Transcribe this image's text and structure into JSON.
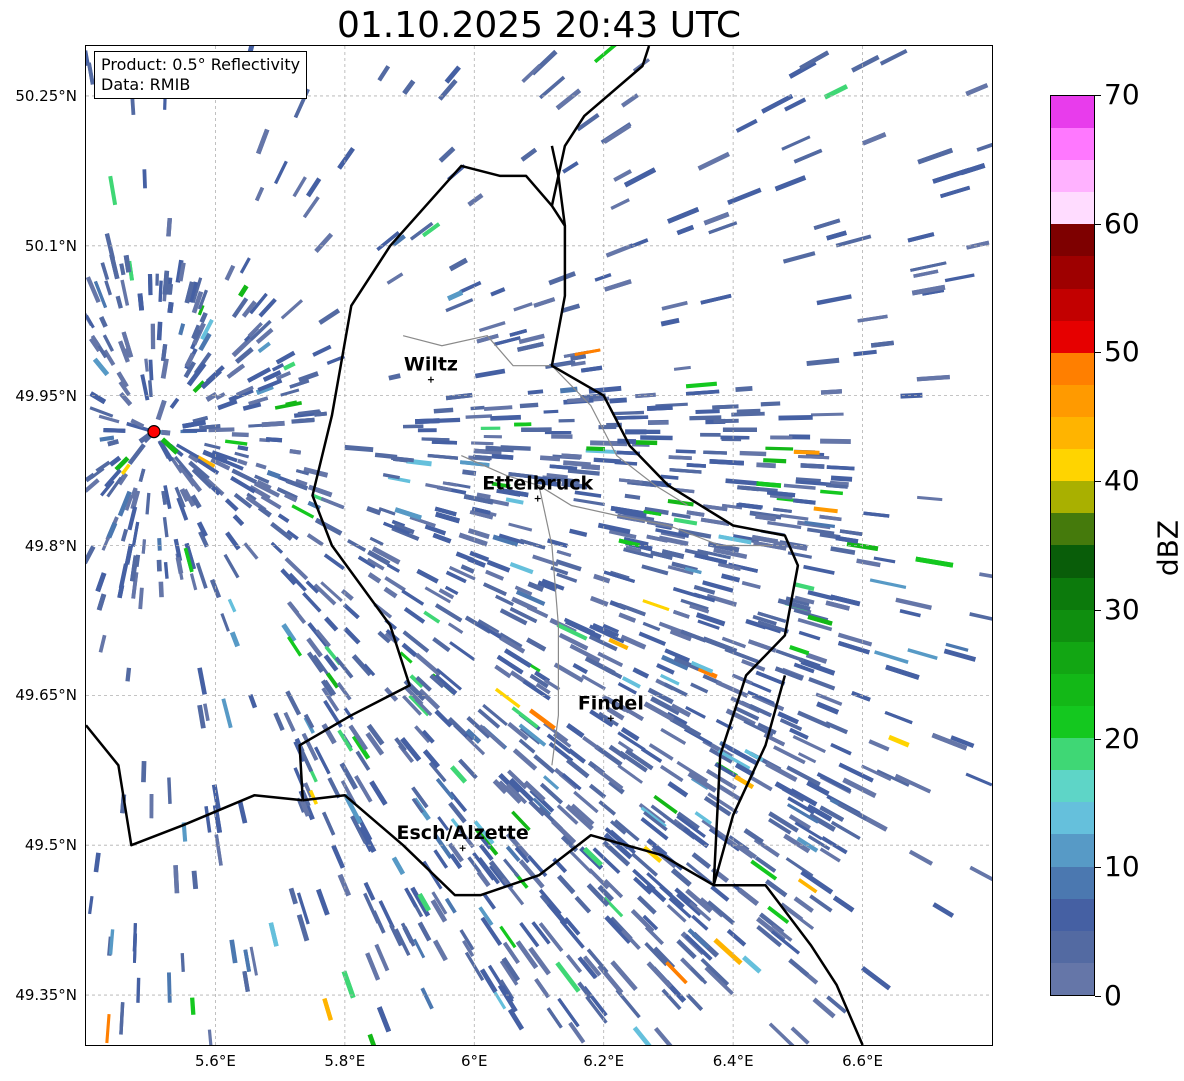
{
  "title": "01.10.2025 20:43 UTC",
  "info": {
    "product": "Product: 0.5° Reflectivity",
    "source": "Data: RMIB"
  },
  "axes": {
    "lon_range": [
      5.4,
      6.8
    ],
    "lat_range": [
      49.3,
      50.3
    ],
    "lat_ticks": [
      {
        "value": 50.25,
        "label": "50.25°N"
      },
      {
        "value": 50.1,
        "label": "50.1°N"
      },
      {
        "value": 49.95,
        "label": "49.95°N"
      },
      {
        "value": 49.8,
        "label": "49.8°N"
      },
      {
        "value": 49.65,
        "label": "49.65°N"
      },
      {
        "value": 49.5,
        "label": "49.5°N"
      },
      {
        "value": 49.35,
        "label": "49.35°N"
      }
    ],
    "lon_ticks": [
      {
        "value": 5.6,
        "label": "5.6°E"
      },
      {
        "value": 5.8,
        "label": "5.8°E"
      },
      {
        "value": 6.0,
        "label": "6°E"
      },
      {
        "value": 6.2,
        "label": "6.2°E"
      },
      {
        "value": 6.4,
        "label": "6.4°E"
      },
      {
        "value": 6.6,
        "label": "6.6°E"
      }
    ],
    "gridlines": true
  },
  "radar_site": {
    "lon": 5.505,
    "lat": 49.914,
    "color": "#ff0000"
  },
  "cities": [
    {
      "name": "Wiltz",
      "lon": 5.933,
      "lat": 49.966
    },
    {
      "name": "Ettelbruck",
      "lon": 6.098,
      "lat": 49.847
    },
    {
      "name": "Findel",
      "lon": 6.211,
      "lat": 49.627
    },
    {
      "name": "Esch/Alzette",
      "lon": 5.982,
      "lat": 49.497
    }
  ],
  "colorbar": {
    "unit": "dBZ",
    "min": 0,
    "max": 70,
    "ticks": [
      "0",
      "10",
      "20",
      "30",
      "40",
      "50",
      "60",
      "70"
    ],
    "colors": [
      "#6576a8",
      "#536aa2",
      "#4560a3",
      "#4b78b0",
      "#579ac6",
      "#65c0dc",
      "#5ed5c7",
      "#3fd775",
      "#14c81f",
      "#13b817",
      "#12a613",
      "#0f8f0f",
      "#0c7a0c",
      "#095d09",
      "#457a0c",
      "#a9b000",
      "#ffd400",
      "#ffb400",
      "#ff9a00",
      "#ff7f00",
      "#e60000",
      "#c20000",
      "#9e0000",
      "#7e0000",
      "#ffdcff",
      "#ffb2ff",
      "#ff78ff",
      "#e83cec"
    ]
  },
  "border_color": "#000000",
  "river_color": "#8a8a8a"
}
